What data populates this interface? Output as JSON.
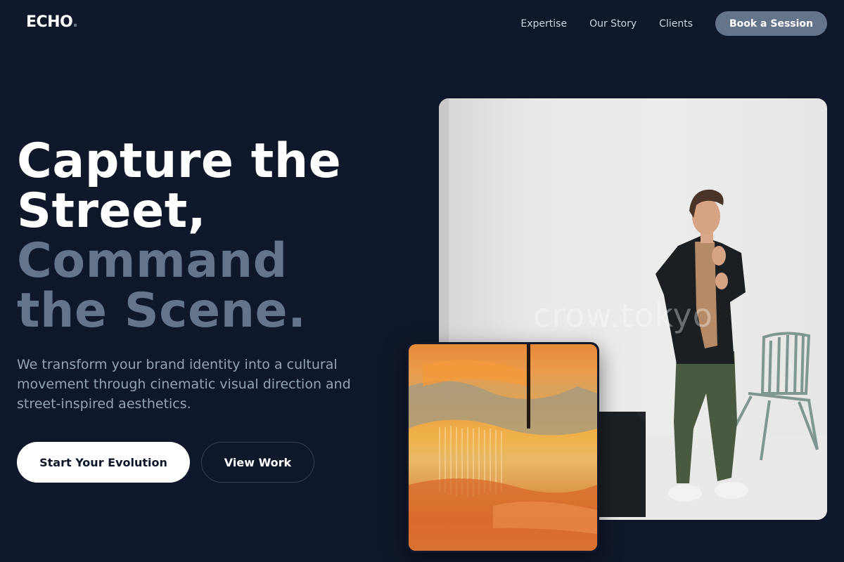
{
  "header": {
    "logo_text": "ECHO",
    "logo_dot": ".",
    "nav": [
      {
        "label": "Expertise"
      },
      {
        "label": "Our Story"
      },
      {
        "label": "Clients"
      }
    ],
    "cta_label": "Book a Session"
  },
  "hero": {
    "title_line1": "Capture the",
    "title_line2": "Street,",
    "title_line3": "Command",
    "title_line4": "the Scene.",
    "subtitle": "We transform your brand identity into a cultural movement through cinematic visual direction and street-inspired aesthetics.",
    "primary_button": "Start Your Evolution",
    "secondary_button": "View Work"
  },
  "images": {
    "main_watermark": "crow.tokyo"
  },
  "colors": {
    "background": "#0f172a",
    "accent": "#64748b",
    "text_primary": "#ffffff",
    "text_secondary": "#94a3b8"
  }
}
